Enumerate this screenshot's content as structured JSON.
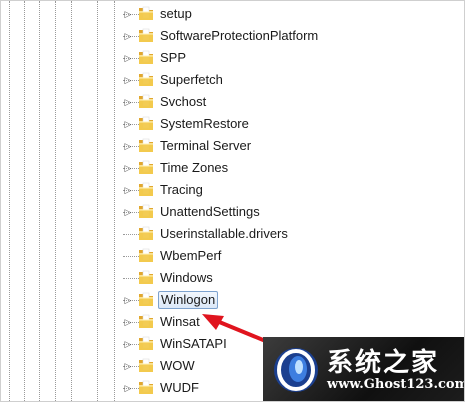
{
  "tree": {
    "items": [
      {
        "label": "setup",
        "expandable": true,
        "selected": false
      },
      {
        "label": "SoftwareProtectionPlatform",
        "expandable": true,
        "selected": false
      },
      {
        "label": "SPP",
        "expandable": true,
        "selected": false
      },
      {
        "label": "Superfetch",
        "expandable": true,
        "selected": false
      },
      {
        "label": "Svchost",
        "expandable": true,
        "selected": false
      },
      {
        "label": "SystemRestore",
        "expandable": true,
        "selected": false
      },
      {
        "label": "Terminal Server",
        "expandable": true,
        "selected": false
      },
      {
        "label": "Time Zones",
        "expandable": true,
        "selected": false
      },
      {
        "label": "Tracing",
        "expandable": true,
        "selected": false
      },
      {
        "label": "UnattendSettings",
        "expandable": true,
        "selected": false
      },
      {
        "label": "Userinstallable.drivers",
        "expandable": false,
        "selected": false
      },
      {
        "label": "WbemPerf",
        "expandable": false,
        "selected": false
      },
      {
        "label": "Windows",
        "expandable": false,
        "selected": false
      },
      {
        "label": "Winlogon",
        "expandable": true,
        "selected": true
      },
      {
        "label": "Winsat",
        "expandable": true,
        "selected": false
      },
      {
        "label": "WinSATAPI",
        "expandable": true,
        "selected": false
      },
      {
        "label": "WOW",
        "expandable": true,
        "selected": false
      },
      {
        "label": "WUDF",
        "expandable": true,
        "selected": false
      }
    ]
  },
  "icons": {
    "folder": "folder-icon",
    "expander": "chevron-right-icon",
    "arrow": "red-arrow-icon",
    "watermark_logo": "ghost-logo-icon"
  },
  "colors": {
    "arrow": "#e0141e",
    "selection_border": "#7da2ce",
    "folder_fill": "#f2c94c"
  },
  "watermark": {
    "title": "系统之家",
    "url": "www.Ghost123.com"
  }
}
